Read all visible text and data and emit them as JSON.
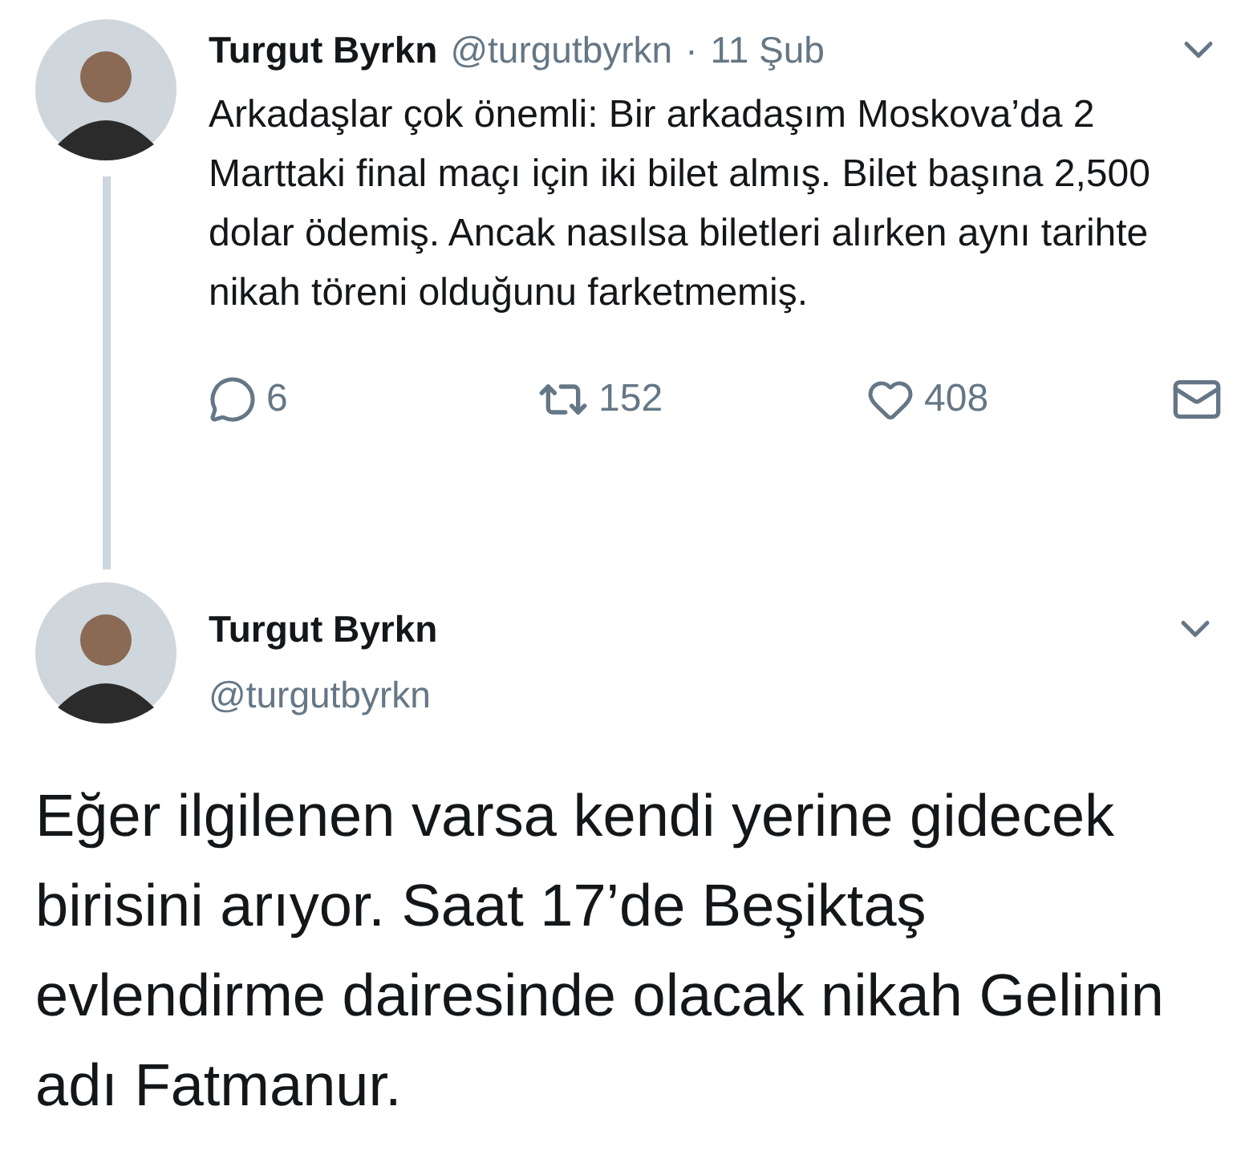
{
  "thread_tweet": {
    "name": "Turgut Byrkn",
    "handle": "@turgutbyrkn",
    "separator": "·",
    "date": "11 Şub",
    "text": "Arkadaşlar çok önemli: Bir arkadaşım Moskova’da 2 Marttaki final maçı için iki bilet almış. Bilet başına 2,500 dolar ödemiş. Ancak nasılsa biletleri alırken aynı tarihte nikah töreni olduğunu farketmemiş.",
    "replies": "6",
    "retweets": "152",
    "likes": "408"
  },
  "main_tweet": {
    "name": "Turgut Byrkn",
    "handle": "@turgutbyrkn",
    "text": "Eğer ilgilenen varsa kendi yerine gidecek birisini arıyor. Saat 17’de Beşiktaş evlendirme dairesinde olacak nikah Gelinin adı Fatmanur."
  }
}
